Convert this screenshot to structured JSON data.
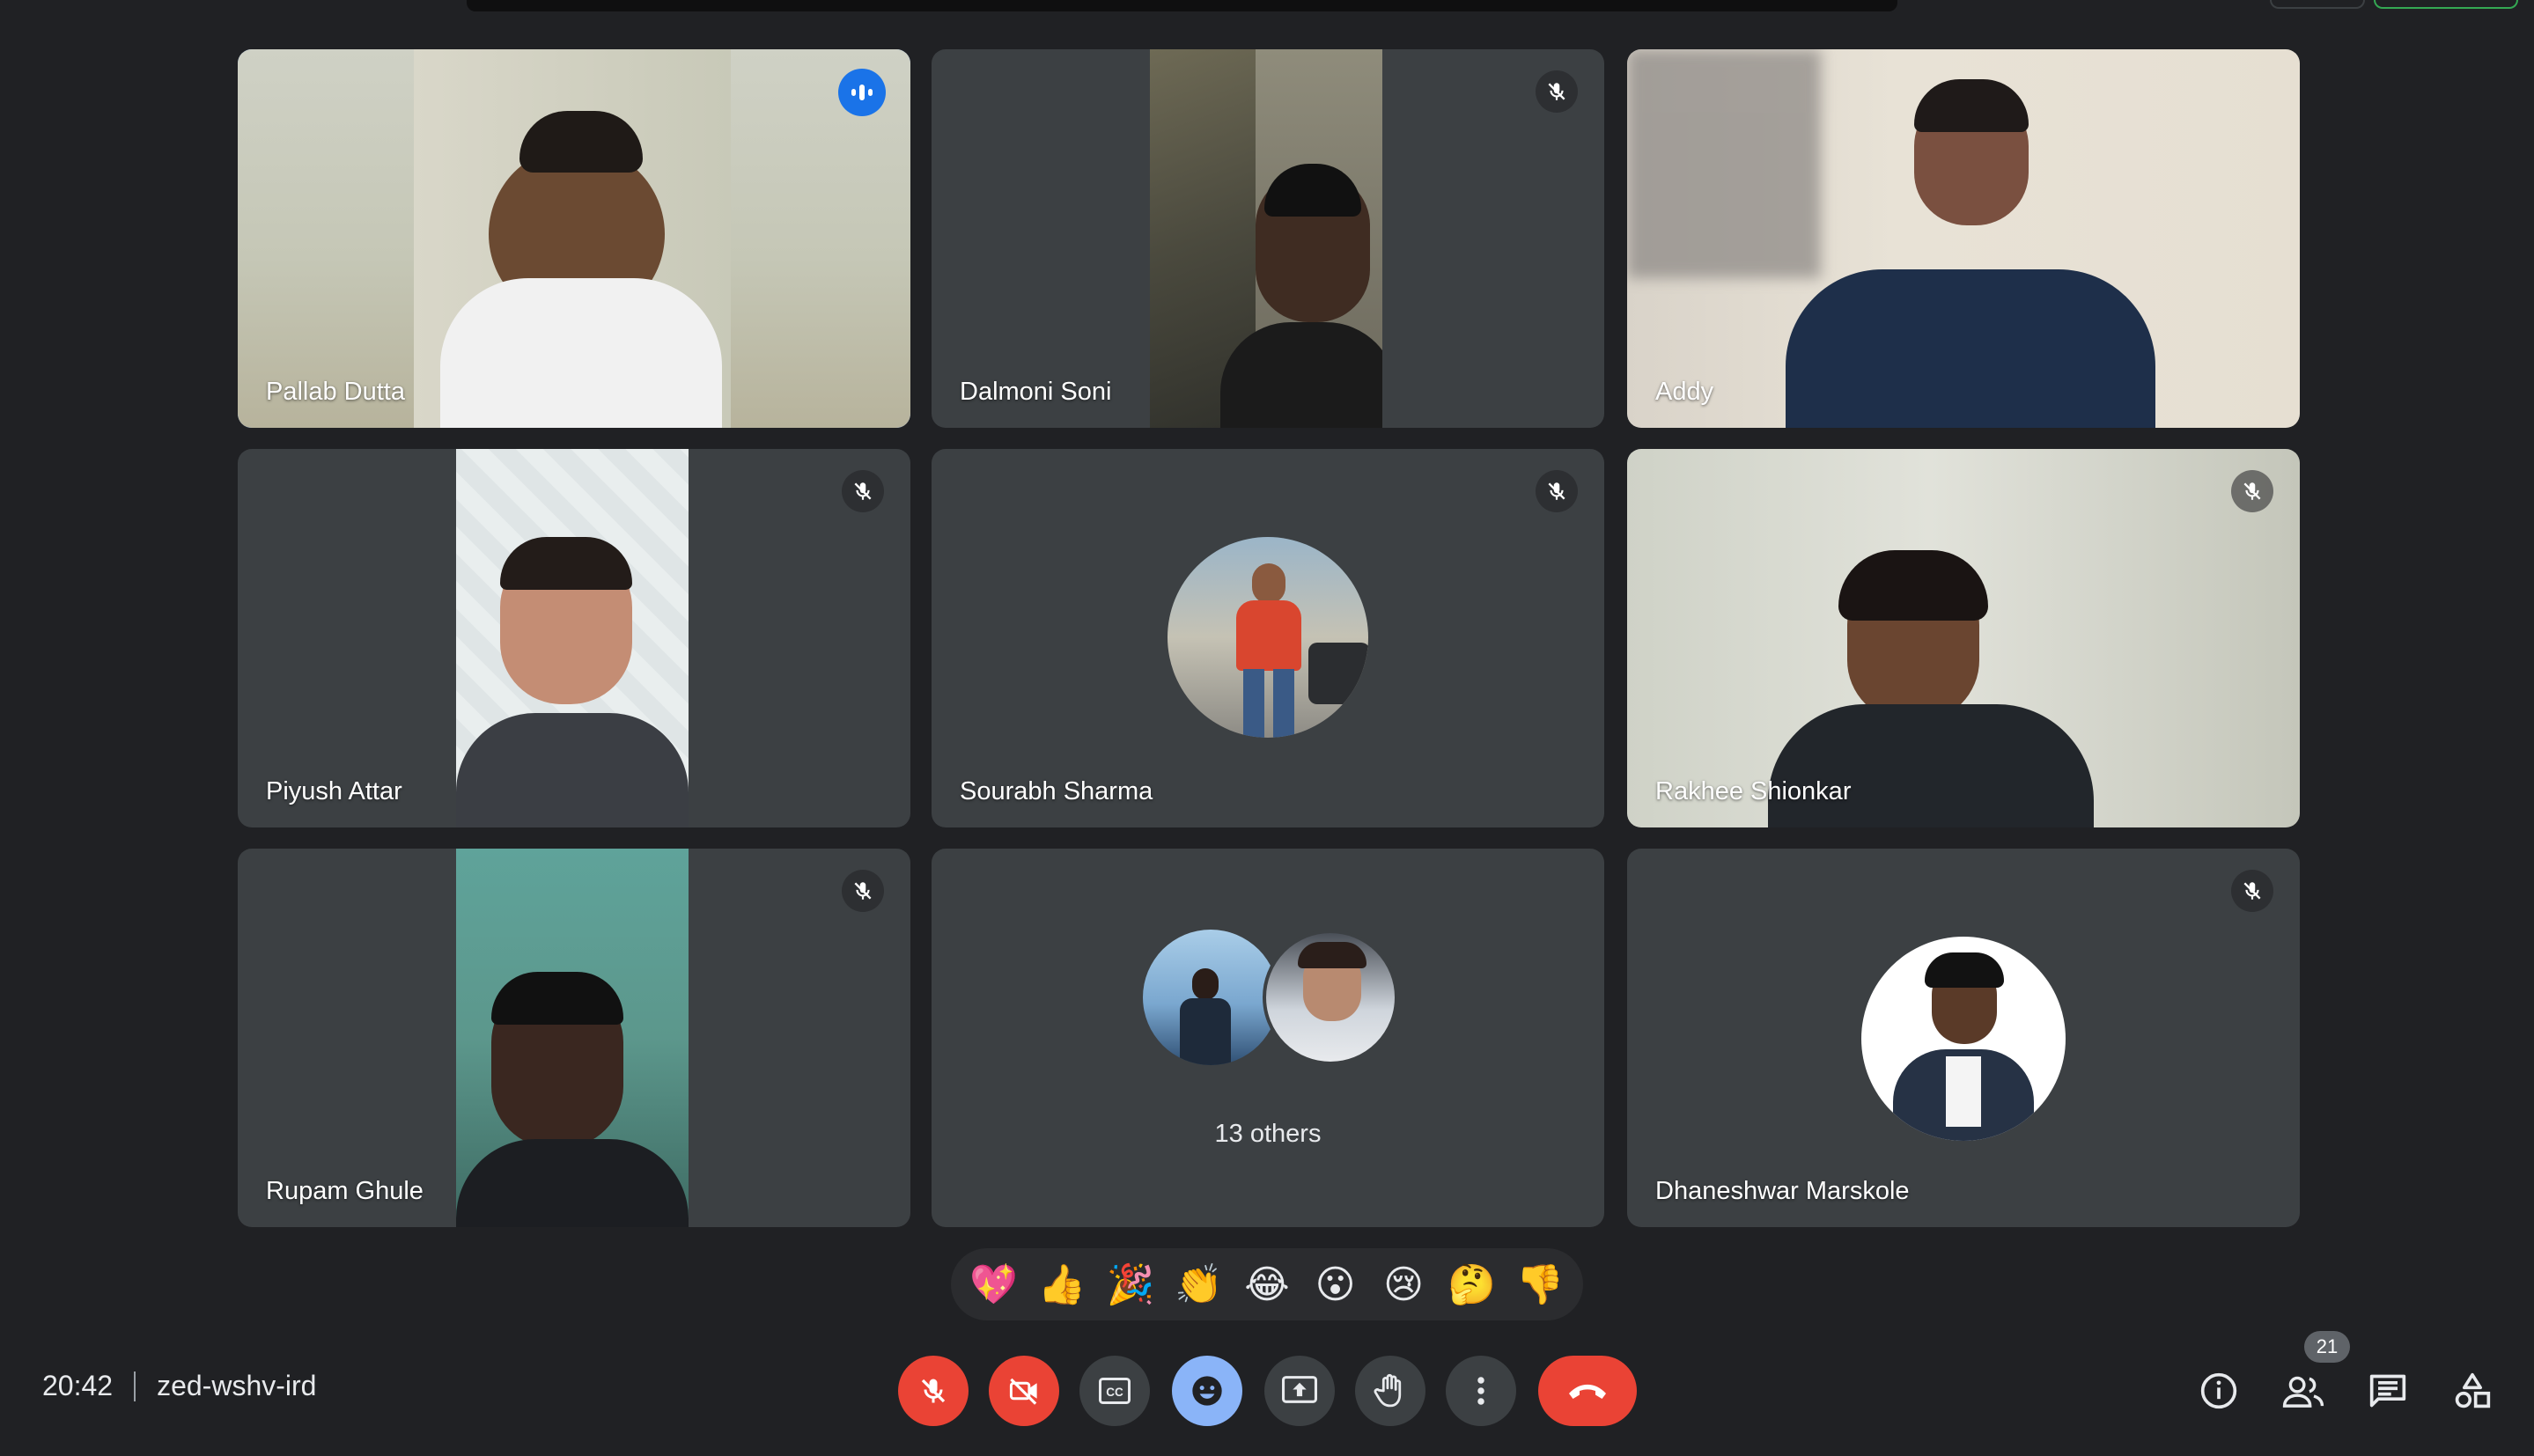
{
  "meeting": {
    "time": "20:42",
    "code": "zed-wshv-ird"
  },
  "participants": [
    {
      "name": "Pallab Dutta"
    },
    {
      "name": "Dalmoni Soni"
    },
    {
      "name": "Addy"
    },
    {
      "name": "Piyush Attar"
    },
    {
      "name": "Sourabh Sharma"
    },
    {
      "name": "Rakhee Shionkar"
    },
    {
      "name": "Rupam Ghule"
    },
    {
      "name": "13 others"
    },
    {
      "name": "Dhaneshwar Marskole"
    }
  ],
  "reactions": [
    "💖",
    "👍",
    "🎉",
    "👏",
    "😂",
    "😮",
    "😢",
    "🤔",
    "👎"
  ],
  "people_count": "21",
  "colors": {
    "background": "#202124",
    "tile": "#3c4043",
    "accent": "#8ab4f8",
    "danger": "#ea4335",
    "speaking": "#1a73e8"
  },
  "icons": {
    "controls": [
      "mic-off-icon",
      "camera-off-icon",
      "captions-icon",
      "emoji-icon",
      "present-icon",
      "raise-hand-icon",
      "more-options-icon",
      "end-call-icon"
    ],
    "right": [
      "info-icon",
      "people-icon",
      "chat-icon",
      "activities-icon"
    ]
  }
}
